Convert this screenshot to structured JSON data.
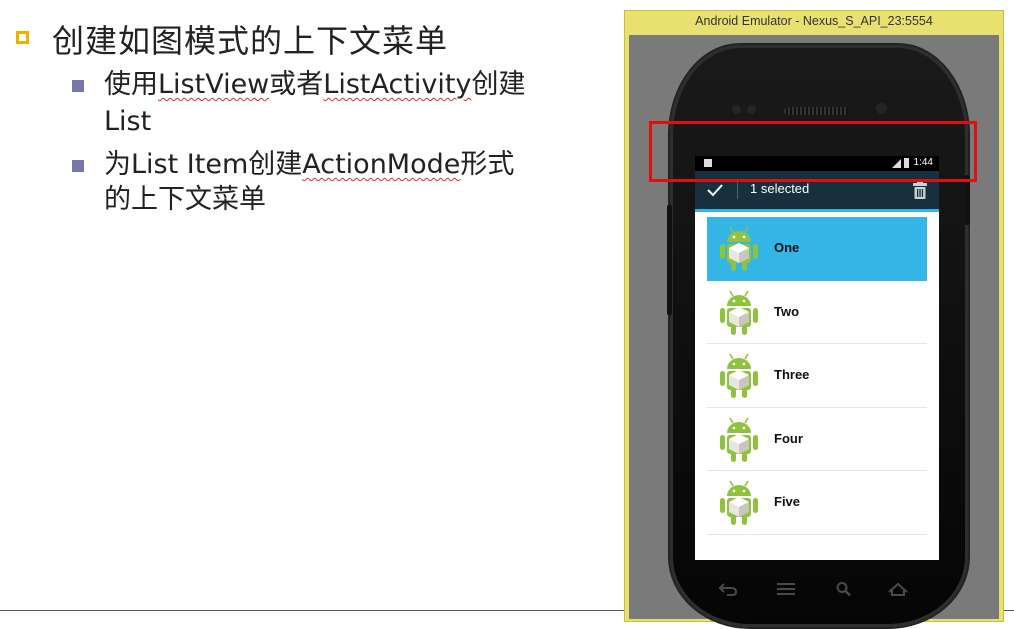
{
  "slide": {
    "title": "创建如图模式的上下文菜单",
    "bullets": [
      {
        "line1_pre": "使用",
        "line1_a": "ListView",
        "line1_mid": "或者",
        "line1_b": "ListActivity",
        "line1_post": "创建",
        "line2": "List"
      },
      {
        "line1_pre": "为",
        "line1_a": "List Item",
        "line1_mid": "创建",
        "line1_b": "ActionMode",
        "line1_post": "形式",
        "line2": "的上下文菜单"
      }
    ]
  },
  "emulator": {
    "window_title": "Android Emulator - Nexus_S_API_23:5554",
    "status_time": "1:44",
    "action_mode_title": "1 selected",
    "list_items": [
      {
        "label": "One",
        "selected": true
      },
      {
        "label": "Two",
        "selected": false
      },
      {
        "label": "Three",
        "selected": false
      },
      {
        "label": "Four",
        "selected": false
      },
      {
        "label": "Five",
        "selected": false
      }
    ]
  },
  "colors": {
    "title_bullet": "#e8b400",
    "sub_bullet": "#7777a8",
    "action_bar": "#18303e",
    "selection": "#33b5e5",
    "highlight_box": "#e01010",
    "emulator_frame": "#e8e070"
  },
  "icons": [
    "check-icon",
    "trash-icon",
    "android-robot-icon",
    "back-icon",
    "menu-icon",
    "search-icon",
    "home-icon"
  ]
}
